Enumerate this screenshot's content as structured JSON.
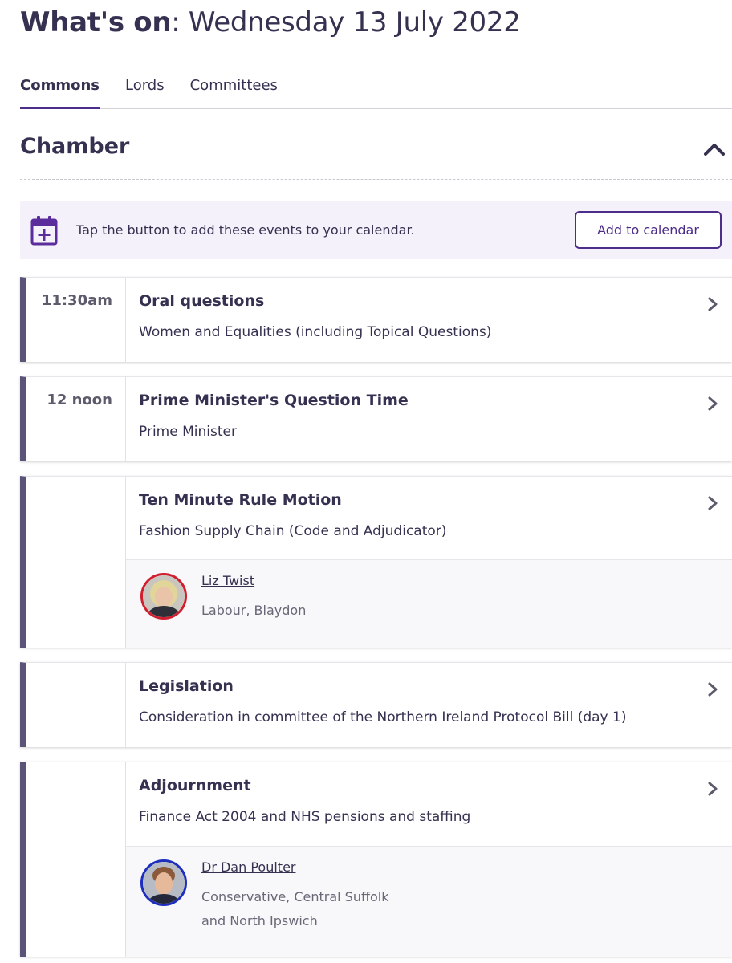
{
  "page": {
    "title_bold": "What's on",
    "title_rest": ": Wednesday 13 July 2022"
  },
  "tabs": [
    {
      "label": "Commons",
      "active": true
    },
    {
      "label": "Lords",
      "active": false
    },
    {
      "label": "Committees",
      "active": false
    }
  ],
  "section": {
    "title": "Chamber",
    "toggle_icon": "chevron-up-icon"
  },
  "calendar_banner": {
    "icon": "calendar-add-icon",
    "text": "Tap the button to add these events to your calendar.",
    "button_label": "Add to calendar"
  },
  "events": [
    {
      "time": "11:30am",
      "title": "Oral questions",
      "subtitle": "Women and Equalities (including Topical Questions)"
    },
    {
      "time": "12 noon",
      "title": "Prime Minister's Question Time",
      "subtitle": "Prime Minister"
    },
    {
      "time": "",
      "title": "Ten Minute Rule Motion",
      "subtitle": "Fashion Supply Chain (Code and Adjudicator)",
      "member": {
        "name": "Liz Twist",
        "party": "Labour, Blaydon",
        "party_color": "#d21f2f"
      }
    },
    {
      "time": "",
      "title": "Legislation",
      "subtitle": "Consideration in committee of the Northern Ireland Protocol Bill (day 1)"
    },
    {
      "time": "",
      "title": "Adjournment",
      "subtitle": "Finance Act 2004 and NHS pensions and staffing",
      "member": {
        "name": "Dr Dan Poulter",
        "party": "Conservative, Central Suffolk and North Ipswich",
        "party_color": "#1e2fbf"
      }
    }
  ],
  "colors": {
    "accent": "#4d2d8a",
    "text": "#373151",
    "event_bar": "#5c5379",
    "banner_bg": "#f4f1fa"
  }
}
